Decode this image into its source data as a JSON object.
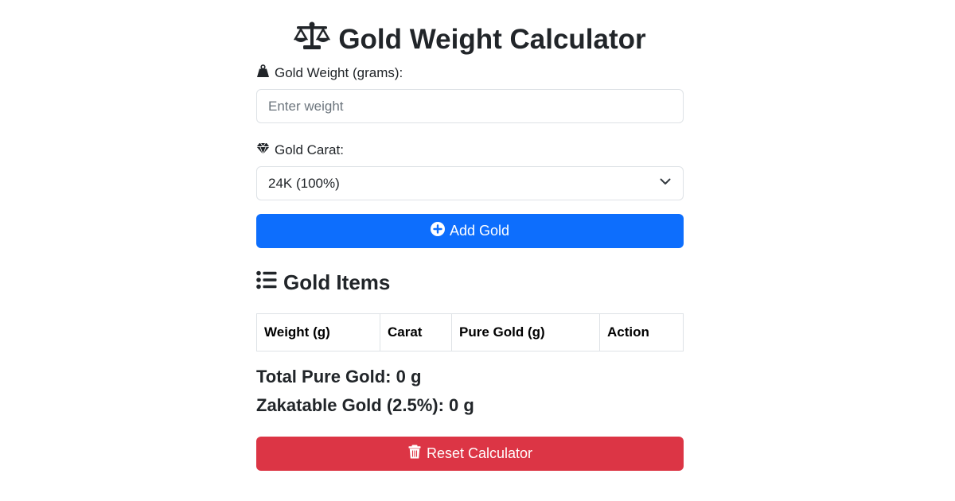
{
  "title": "Gold Weight Calculator",
  "weight_field": {
    "label": "Gold Weight (grams):",
    "placeholder": "Enter weight",
    "value": ""
  },
  "carat_field": {
    "label": "Gold Carat:",
    "selected": "24K (100%)"
  },
  "add_button": {
    "label": "Add Gold"
  },
  "items_section": {
    "title": "Gold Items",
    "columns": [
      "Weight (g)",
      "Carat",
      "Pure Gold (g)",
      "Action"
    ],
    "rows": []
  },
  "totals": {
    "pure_gold": "Total Pure Gold: 0 g",
    "zakatable": "Zakatable Gold (2.5%): 0 g"
  },
  "reset_button": {
    "label": "Reset Calculator"
  },
  "colors": {
    "primary": "#0d6efd",
    "danger": "#dc3545",
    "border": "#dee2e6",
    "text": "#212529"
  },
  "icons": {
    "title": "balance-scale-icon",
    "weight": "weight-hanging-icon",
    "carat": "gem-icon",
    "add": "plus-circle-icon",
    "list": "list-icon",
    "dropdown": "chevron-down-icon",
    "reset": "trash-icon"
  }
}
